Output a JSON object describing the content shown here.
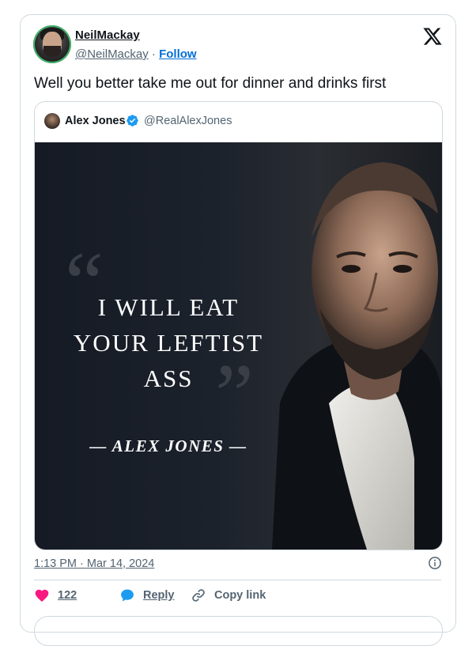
{
  "author": {
    "name": "NeilMackay",
    "handle": "@NeilMackay",
    "separator": "·",
    "follow_label": "Follow"
  },
  "tweet": {
    "text": "Well you better take me out for dinner and drinks first",
    "timestamp": "1:13 PM · Mar 14, 2024"
  },
  "quoted": {
    "name": "Alex Jones",
    "handle": "@RealAlexJones",
    "image": {
      "quote_lines": [
        "I WILL EAT",
        "YOUR LEFTIST",
        "ASS"
      ],
      "author_line": "— ALEX JONES —",
      "open_quote": "“",
      "close_quote": "”"
    }
  },
  "actions": {
    "like_count": "122",
    "reply_label": "Reply",
    "copy_label": "Copy link"
  },
  "colors": {
    "link": "#006fd6",
    "muted": "#536471",
    "heart": "#f91880",
    "reply": "#1d9bf0",
    "verified": "#1d9bf0",
    "border": "#cfd9de"
  },
  "icons": {
    "logo": "x-logo-icon",
    "verified": "verified-badge-icon",
    "info": "info-icon",
    "like": "heart-icon",
    "reply": "speech-bubble-icon",
    "copy": "link-icon"
  }
}
